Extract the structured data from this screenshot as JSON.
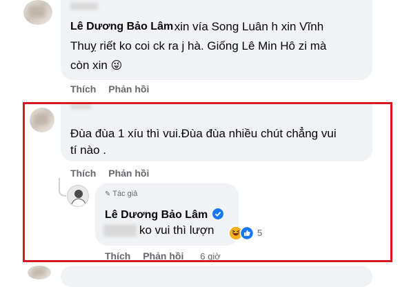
{
  "comments": [
    {
      "author": "Lê Dương Bảo Lâm",
      "text_line1": " xin vía Song Luân h xin Vĩnh",
      "text_line2": "Thuỵ riết ko coi ck ra j hà. Giống Lê Min Hô zi mà",
      "text_line3": "còn xin",
      "emoji": "😜",
      "actions": {
        "like": "Thích",
        "reply": "Phản hồi"
      }
    },
    {
      "text_line1": "Đùa đùa 1 xíu thì vui.Đùa đùa nhiều chút chẳng vui",
      "text_line2": "tí nào .",
      "actions": {
        "like": "Thích",
        "reply": "Phản hồi"
      }
    }
  ],
  "reply": {
    "badge": "Tác giả",
    "author": "Lê Dương Bảo Lâm",
    "verified_icon": "verified-badge-icon",
    "text": "ko vui thì lượn",
    "reaction_count": "5",
    "actions": {
      "like": "Thích",
      "reply": "Phản hồi",
      "time": "6 giờ"
    }
  },
  "colors": {
    "highlight_border": "#d7181f",
    "bubble": "#f0f2f5",
    "verified": "#1877f2"
  }
}
